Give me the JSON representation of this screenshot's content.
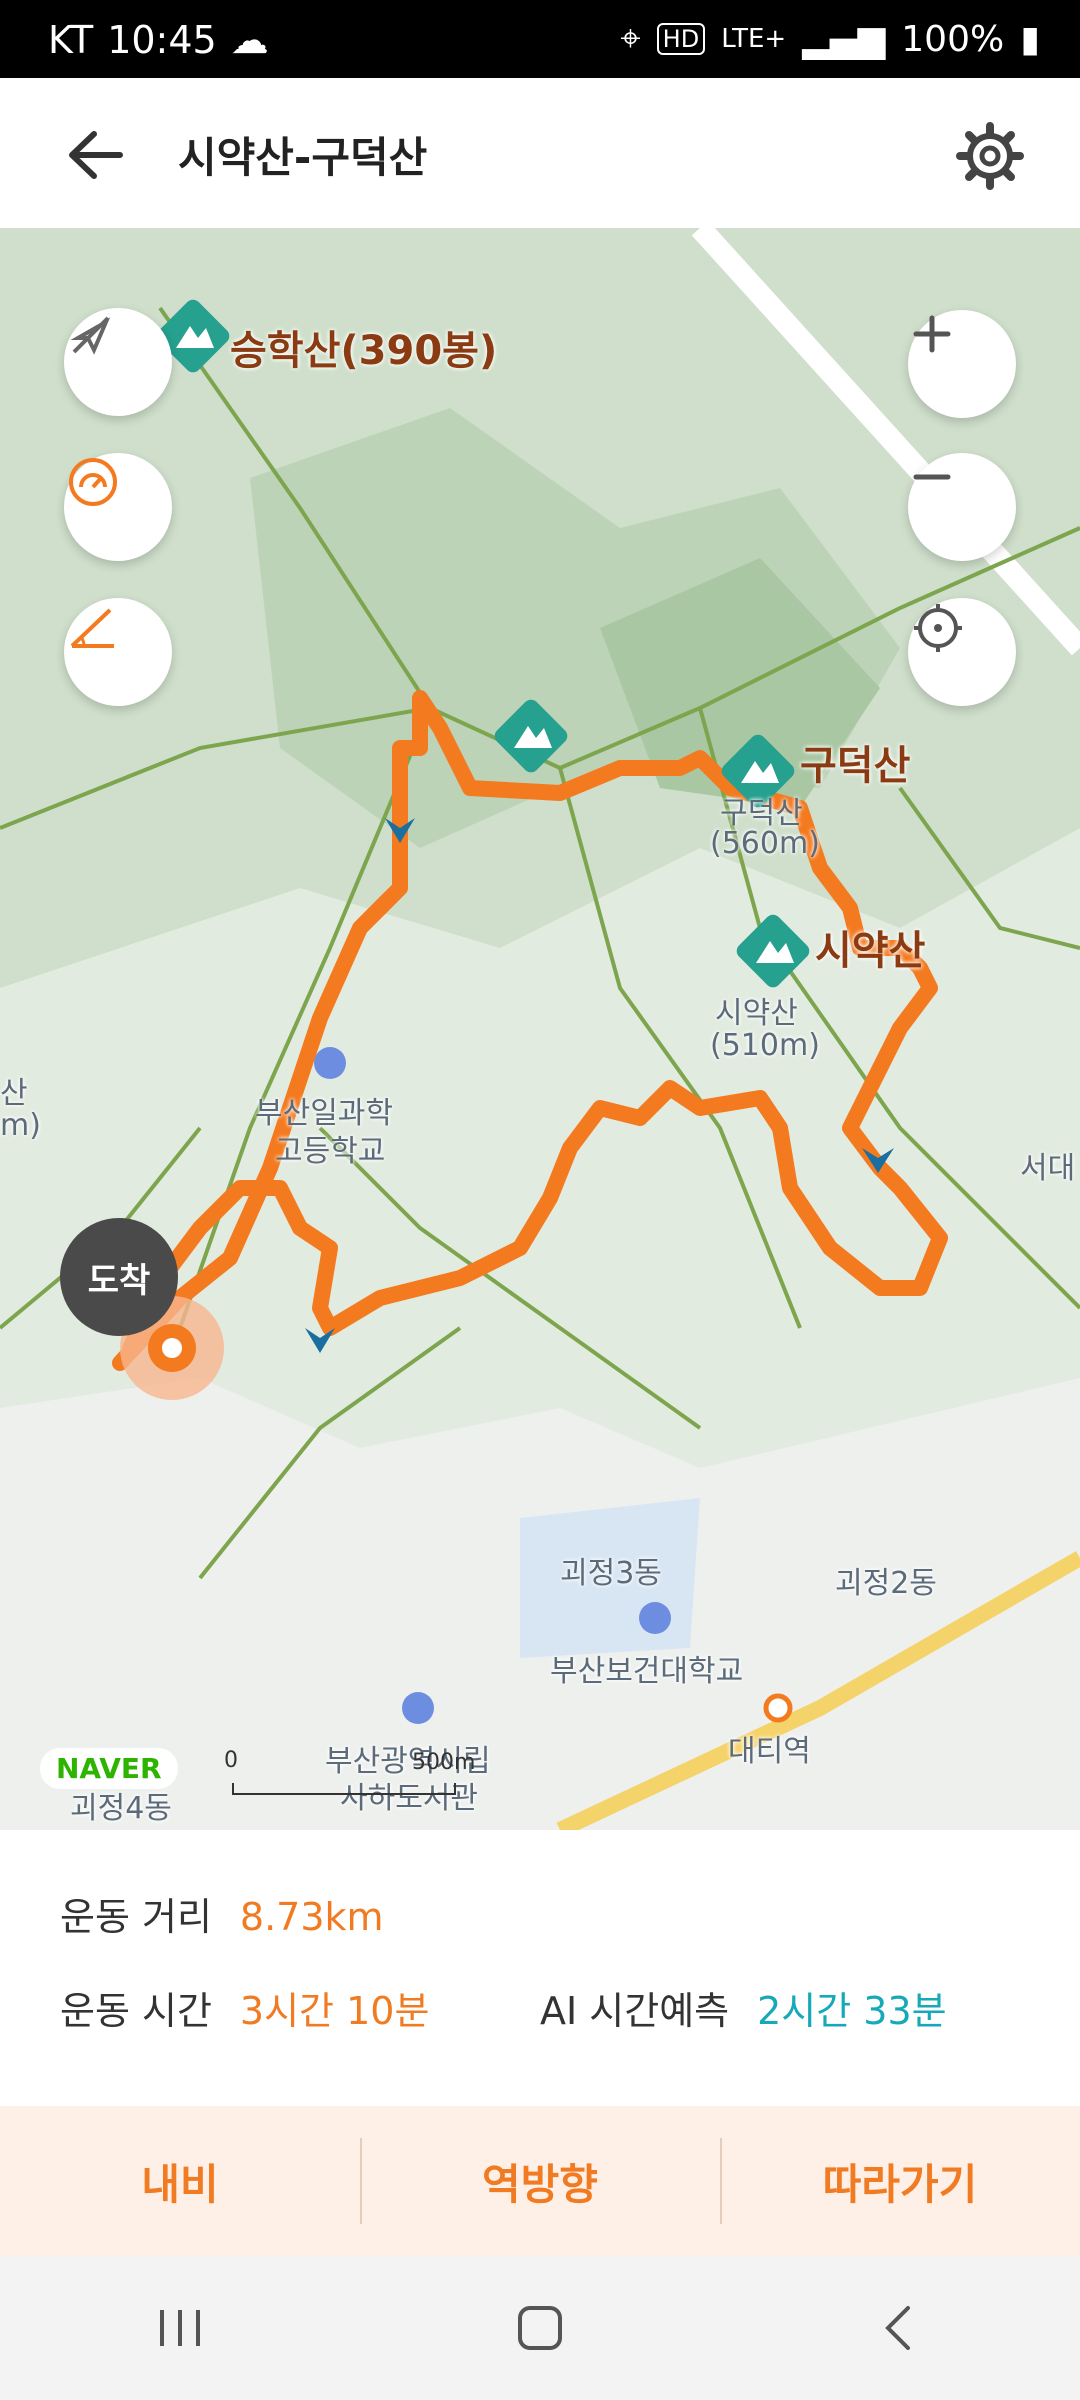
{
  "status_bar": {
    "carrier": "KT",
    "time": "10:45",
    "hd_label": "HD",
    "network": "LTE+",
    "battery": "100%"
  },
  "header": {
    "title": "시약산-구덕산",
    "back_icon": "arrow-left-icon",
    "settings_icon": "gear-icon"
  },
  "map": {
    "peak_labels": [
      "승학산(390봉)",
      "구덕산",
      "시약산"
    ],
    "area_labels": {
      "guduk_sub": "구덕산",
      "guduk_elev": "(560m)",
      "siyak_sub": "시약산",
      "siyak_elev": "(510m)",
      "school1": "부산일과학",
      "school1b": "고등학교",
      "gwejeong3": "괴정3동",
      "gwejeong2": "괴정2동",
      "gwejeong4": "괴정4동",
      "univ": "부산보건대학교",
      "station": "대티역",
      "library1": "부산광역시립",
      "library2": "사하도서관",
      "east": "서대",
      "west": "산",
      "west2": "m)"
    },
    "arrive_label": "도착",
    "naver": "NAVER",
    "scale_zero": "0",
    "scale_label": "500m",
    "route_color": "#f47a20"
  },
  "summary": {
    "distance_label": "운동 거리",
    "distance_value": "8.73km",
    "time_label": "운동 시간",
    "time_value": "3시간 10분",
    "ai_label": "AI 시간예측",
    "ai_value": "2시간 33분"
  },
  "actions": [
    "내비",
    "역방향",
    "따라가기"
  ],
  "nav": [
    "recent-apps-icon",
    "home-icon",
    "back-icon"
  ]
}
